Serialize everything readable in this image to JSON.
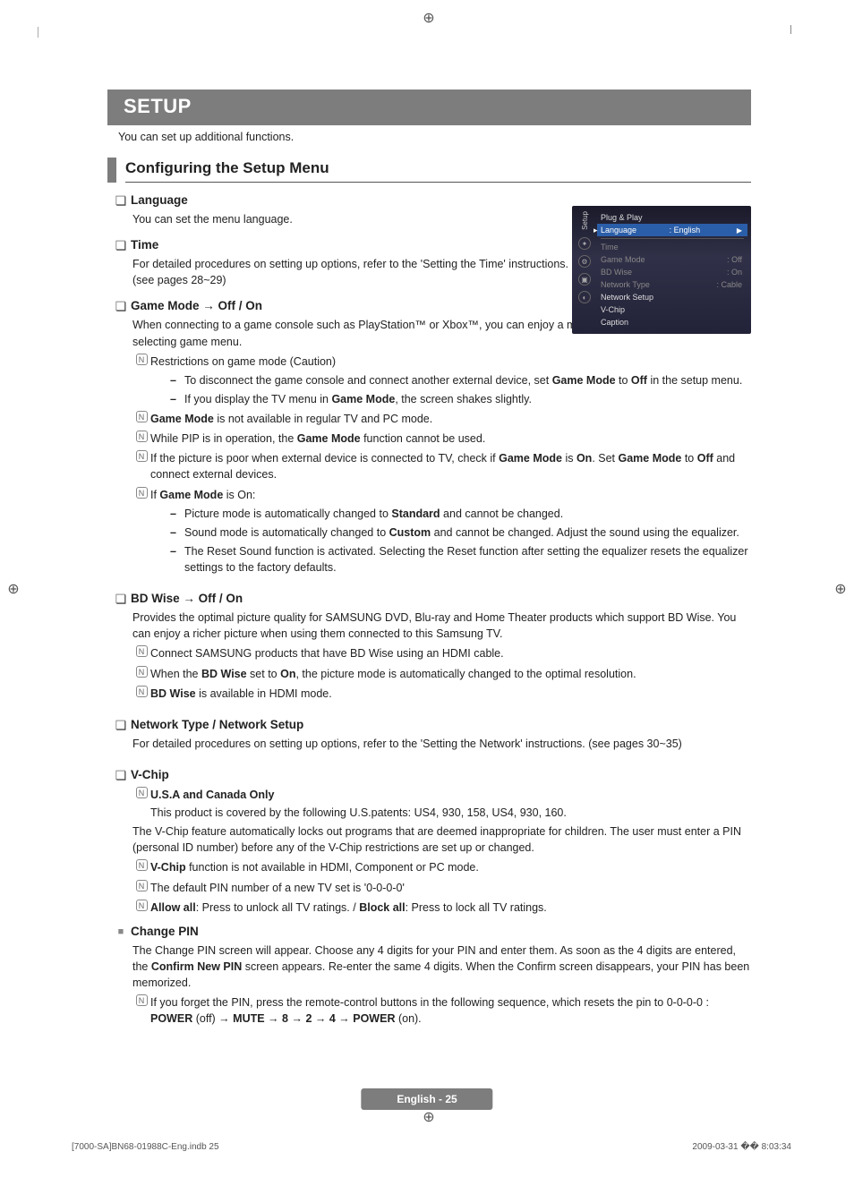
{
  "section_title": "SETUP",
  "intro": "You can set up additional functions.",
  "subhead": "Configuring the Setup Menu",
  "osd": {
    "side_label": "Setup",
    "items": [
      {
        "label": "Plug & Play",
        "value": ""
      },
      {
        "label": "Language",
        "value": ": English",
        "selected": true
      },
      {
        "label": "Time",
        "value": "",
        "dim": true
      },
      {
        "label": "Game Mode",
        "value": ": Off",
        "dim": true
      },
      {
        "label": "BD Wise",
        "value": ": On",
        "dim": true
      },
      {
        "label": "Network Type",
        "value": ": Cable",
        "dim": true
      },
      {
        "label": "Network Setup",
        "value": "",
        "dim": false
      },
      {
        "label": "V-Chip",
        "value": "",
        "dim": false
      },
      {
        "label": "Caption",
        "value": "",
        "dim": false
      }
    ]
  },
  "lang": {
    "title": "Language",
    "body": "You can set the menu language."
  },
  "time": {
    "title": "Time",
    "body": "For detailed procedures on setting up options, refer to the 'Setting the Time' instructions. (see pages 28~29)"
  },
  "game": {
    "title": "Game Mode → Off / On",
    "body": "When connecting to a game console such as PlayStation™ or Xbox™, you can enjoy a more realistic gaming experience by selecting game menu.",
    "n1": "Restrictions on game mode (Caution)",
    "d1a_pre": "To disconnect the game console and connect another external device, set ",
    "d1a_b1": "Game Mode",
    "d1a_mid": " to ",
    "d1a_b2": "Off",
    "d1a_post": " in the setup menu.",
    "d1b_pre": "If you display the TV menu in ",
    "d1b_b1": "Game Mode",
    "d1b_post": ", the screen shakes slightly.",
    "n2_b": "Game Mode",
    "n2_post": " is not available in regular TV and PC mode.",
    "n3_pre": "While PIP is in operation, the ",
    "n3_b": "Game Mode",
    "n3_post": " function cannot be used.",
    "n4_pre": "If the picture is poor when external device is connected to TV, check if ",
    "n4_b1": "Game Mode",
    "n4_mid1": " is ",
    "n4_b2": "On",
    "n4_mid2": ". Set ",
    "n4_b3": "Game Mode",
    "n4_mid3": " to ",
    "n4_b4": "Off",
    "n4_post": " and connect external devices.",
    "n5_pre": "If ",
    "n5_b": "Game Mode",
    "n5_post": " is On:",
    "d5a_pre": "Picture mode is automatically changed to ",
    "d5a_b": "Standard",
    "d5a_post": " and cannot be changed.",
    "d5b_pre": "Sound mode is automatically changed to ",
    "d5b_b": "Custom",
    "d5b_post": " and cannot be changed. Adjust the sound using the equalizer.",
    "d5c": "The Reset Sound function is activated. Selecting the Reset function after setting the equalizer resets the equalizer settings to the factory defaults."
  },
  "bd": {
    "title": "BD Wise → Off / On",
    "body": "Provides the optimal picture quality for SAMSUNG DVD, Blu-ray and Home Theater products which support BD Wise. You can enjoy a richer picture when using them connected to this Samsung TV.",
    "n1": "Connect SAMSUNG products that have BD Wise using an HDMI cable.",
    "n2_pre": "When the ",
    "n2_b1": "BD Wise",
    "n2_mid1": " set to ",
    "n2_b2": "On",
    "n2_post": ", the picture mode is automatically changed to the optimal resolution.",
    "n3_b": "BD Wise",
    "n3_post": " is available in HDMI mode."
  },
  "net": {
    "title": "Network Type / Network Setup",
    "body": "For detailed procedures on setting up options, refer to the 'Setting the Network' instructions. (see pages 30~35)"
  },
  "vchip": {
    "title": "V-Chip",
    "n1_b": "U.S.A and Canada Only",
    "n1_body": "This product is covered by the following U.S.patents: US4, 930, 158, US4, 930, 160.",
    "body": "The V-Chip feature automatically locks out programs that are deemed inappropriate for children. The user must enter a PIN (personal ID number) before any of the V-Chip restrictions are set up or changed.",
    "n2_b": "V-Chip",
    "n2_post": " function is not available in HDMI, Component or PC mode.",
    "n3": "The default PIN number of a new TV set is '0-0-0-0'",
    "n4_b1": "Allow all",
    "n4_mid1": ": Press to unlock all TV ratings. / ",
    "n4_b2": "Block all",
    "n4_post": ": Press to lock all TV ratings."
  },
  "pin": {
    "title": "Change PIN",
    "body_pre": "The Change PIN screen will appear. Choose any 4 digits for your PIN and enter them. As soon as the 4 digits are entered, the ",
    "body_b": "Confirm New PIN",
    "body_post": " screen appears. Re-enter the same 4 digits. When the Confirm screen disappears, your PIN has been memorized.",
    "n1_pre": "If you forget the PIN, press the remote-control buttons in the following sequence, which resets the pin to 0-0-0-0 : ",
    "n1_b1": "POWER",
    "n1_mid1": " (off) → ",
    "n1_b2": "MUTE",
    "n1_mid2": " → ",
    "n1_b3": "8",
    "n1_mid3": " → ",
    "n1_b4": "2",
    "n1_mid4": " → ",
    "n1_b5": "4",
    "n1_mid5": " → ",
    "n1_b6": "POWER",
    "n1_post": " (on)."
  },
  "footer": "English - 25",
  "meta_left": "[7000-SA]BN68-01988C-Eng.indb   25",
  "meta_right": "2009-03-31   �� 8:03:34"
}
